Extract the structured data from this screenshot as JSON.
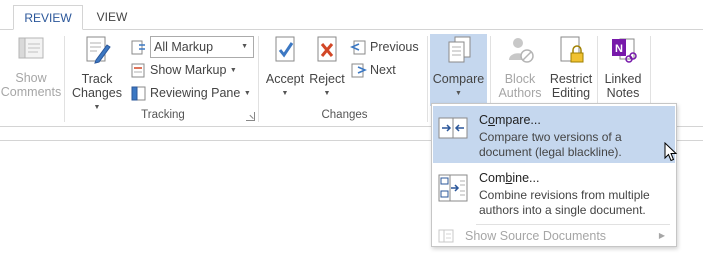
{
  "tabs": [
    {
      "label": "REVIEW",
      "active": true
    },
    {
      "label": "VIEW",
      "active": false
    }
  ],
  "comments": {
    "show_comments_line1": "Show",
    "show_comments_line2": "Comments"
  },
  "tracking": {
    "track_changes_line1": "Track",
    "track_changes_line2": "Changes",
    "markup_select_value": "All Markup",
    "show_markup_label": "Show Markup",
    "reviewing_pane_label": "Reviewing Pane",
    "group_label": "Tracking"
  },
  "changes": {
    "accept_label": "Accept",
    "reject_label": "Reject",
    "previous_label": "Previous",
    "next_label": "Next",
    "group_label": "Changes"
  },
  "compare": {
    "compare_label": "Compare"
  },
  "protect": {
    "block_line1": "Block",
    "block_line2": "Authors",
    "restrict_line1": "Restrict",
    "restrict_line2": "Editing"
  },
  "onenote": {
    "linked_line1": "Linked",
    "linked_line2": "Notes"
  },
  "compare_menu": {
    "compare_title_pre": "C",
    "compare_title_u": "o",
    "compare_title_post": "mpare...",
    "compare_desc": "Compare two versions of a document (legal blackline).",
    "combine_title_pre": "Com",
    "combine_title_u": "b",
    "combine_title_post": "ine...",
    "combine_desc": "Combine revisions from multiple authors into a single document.",
    "show_source_label": "Show Source Documents"
  },
  "colors": {
    "accent": "#2b579a",
    "highlight": "#c5d7ee",
    "onenote": "#7719aa"
  }
}
